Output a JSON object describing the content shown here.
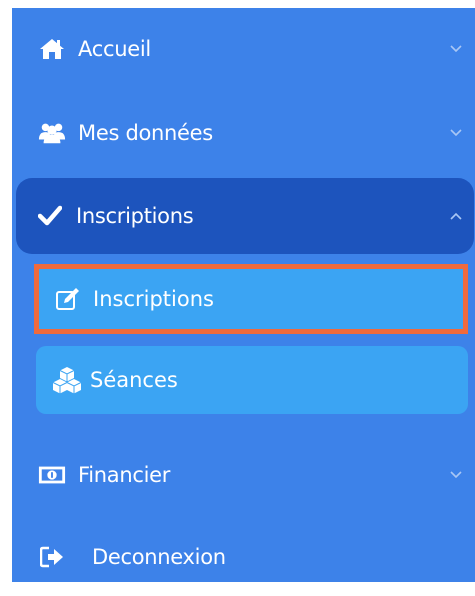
{
  "sidebar": {
    "items": [
      {
        "label": "Accueil",
        "icon": "home-icon",
        "has_chevron": true
      },
      {
        "label": "Mes données",
        "icon": "users-icon",
        "has_chevron": true
      },
      {
        "label": "Inscriptions",
        "icon": "check-icon",
        "has_chevron": true,
        "expanded": true
      },
      {
        "label": "Financier",
        "icon": "money-icon",
        "has_chevron": true
      },
      {
        "label": "Deconnexion",
        "icon": "logout-icon",
        "has_chevron": false
      }
    ],
    "submenu": [
      {
        "label": "Inscriptions",
        "icon": "edit-icon",
        "highlighted": true
      },
      {
        "label": "Séances",
        "icon": "cubes-icon"
      }
    ]
  },
  "colors": {
    "sidebar_bg": "#3d82e9",
    "active_bg": "#1d54bd",
    "submenu_bg": "#3ba4f3",
    "highlight_border": "#ef6a3d"
  }
}
